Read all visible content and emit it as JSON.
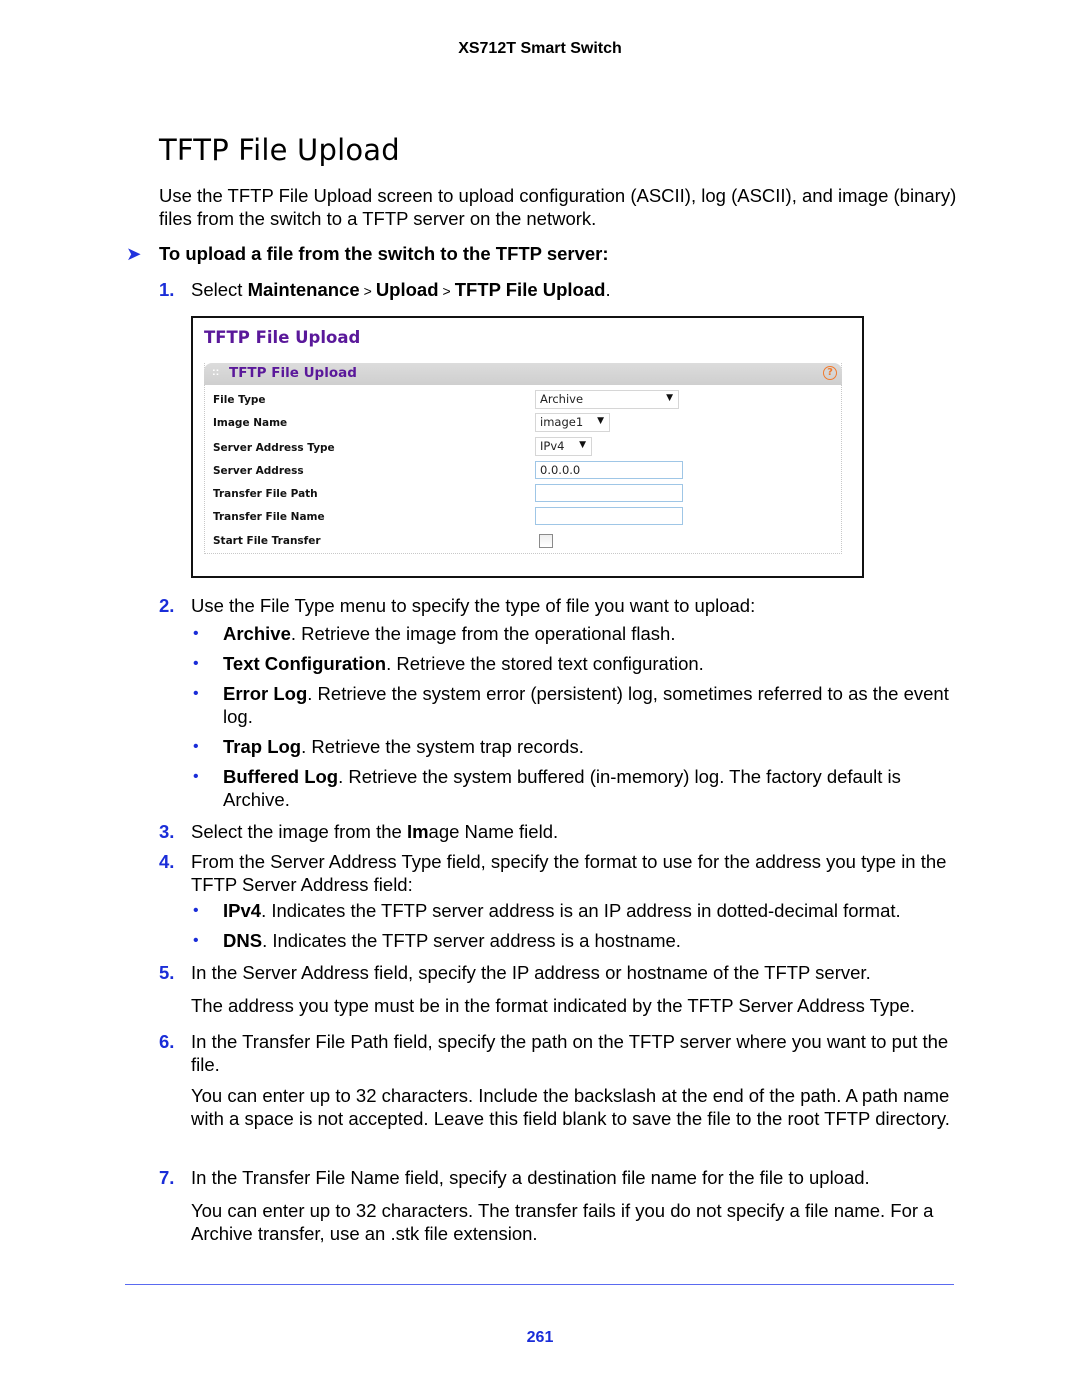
{
  "header": {
    "product": "XS712T Smart Switch"
  },
  "page_title": "TFTP File Upload",
  "intro": "Use the TFTP File Upload screen to upload configuration (ASCII), log (ASCII), and image (binary) files from the switch to a TFTP server on the network.",
  "procedure_heading": "To upload a file from the switch to the TFTP server:",
  "steps": [
    {
      "num": "1.",
      "prefix": "Select ",
      "path": [
        "Maintenance",
        "Upload",
        "TFTP File Upload"
      ],
      "separator": ">",
      "suffix": "."
    },
    {
      "num": "2.",
      "text": "Use the File Type menu to specify the type of file you want to upload:",
      "bullets": [
        {
          "term": "Archive",
          "desc": ". Retrieve the image from the operational flash."
        },
        {
          "term": "Text Configuration",
          "desc": ". Retrieve the stored text configuration."
        },
        {
          "term": "Error Log",
          "desc": ". Retrieve the system error (persistent) log, sometimes referred to as the event log."
        },
        {
          "term": "Trap Log",
          "desc": ". Retrieve the system trap records."
        },
        {
          "term": "Buffered Log",
          "desc": ". Retrieve the system buffered (in-memory) log. The factory default is Archive."
        }
      ]
    },
    {
      "num": "3.",
      "pre": "Select the image from the ",
      "bold": "Im",
      "post": "age Name field."
    },
    {
      "num": "4.",
      "text": "From the Server Address Type field, specify the format to use for the address you type in the TFTP Server Address field:",
      "bullets": [
        {
          "term": "IPv4",
          "desc": ". Indicates the TFTP server address is an IP address in dotted-decimal format."
        },
        {
          "term": "DNS",
          "desc": ". Indicates the TFTP server address is a hostname."
        }
      ]
    },
    {
      "num": "5.",
      "text": "In the Server Address field, specify the IP address or hostname of the TFTP server.",
      "note": "The address you type must be in the format indicated by the TFTP Server Address Type."
    },
    {
      "num": "6.",
      "text": "In the Transfer File Path field, specify the path on the TFTP server where you want to put the file.",
      "note": "You can enter up to 32 characters. Include the backslash at the end of the path. A path name with a space is not accepted. Leave this field blank to save the file to the root TFTP directory."
    },
    {
      "num": "7.",
      "text": "In the Transfer File Name field, specify a destination file name for the file to upload.",
      "note": "You can enter up to 32 characters. The transfer fails if you do not specify a file name. For a Archive transfer, use an .stk file extension."
    }
  ],
  "screenshot": {
    "title": "TFTP File Upload",
    "panel_title": "TFTP File Upload",
    "help_icon": "?",
    "fields": [
      {
        "label": "File Type",
        "type": "select",
        "value": "Archive"
      },
      {
        "label": "Image Name",
        "type": "select",
        "value": "image1"
      },
      {
        "label": "Server Address Type",
        "type": "select",
        "value": "IPv4"
      },
      {
        "label": "Server Address",
        "type": "text",
        "value": "0.0.0.0"
      },
      {
        "label": "Transfer File Path",
        "type": "text",
        "value": ""
      },
      {
        "label": "Transfer File Name",
        "type": "text",
        "value": ""
      },
      {
        "label": "Start File Transfer",
        "type": "checkbox",
        "checked": false
      }
    ]
  },
  "footer": {
    "page_number": "261"
  },
  "colors": {
    "accent_blue": "#1a2dd8",
    "ui_purple": "#5a189a",
    "help_orange": "#f07a2e"
  }
}
